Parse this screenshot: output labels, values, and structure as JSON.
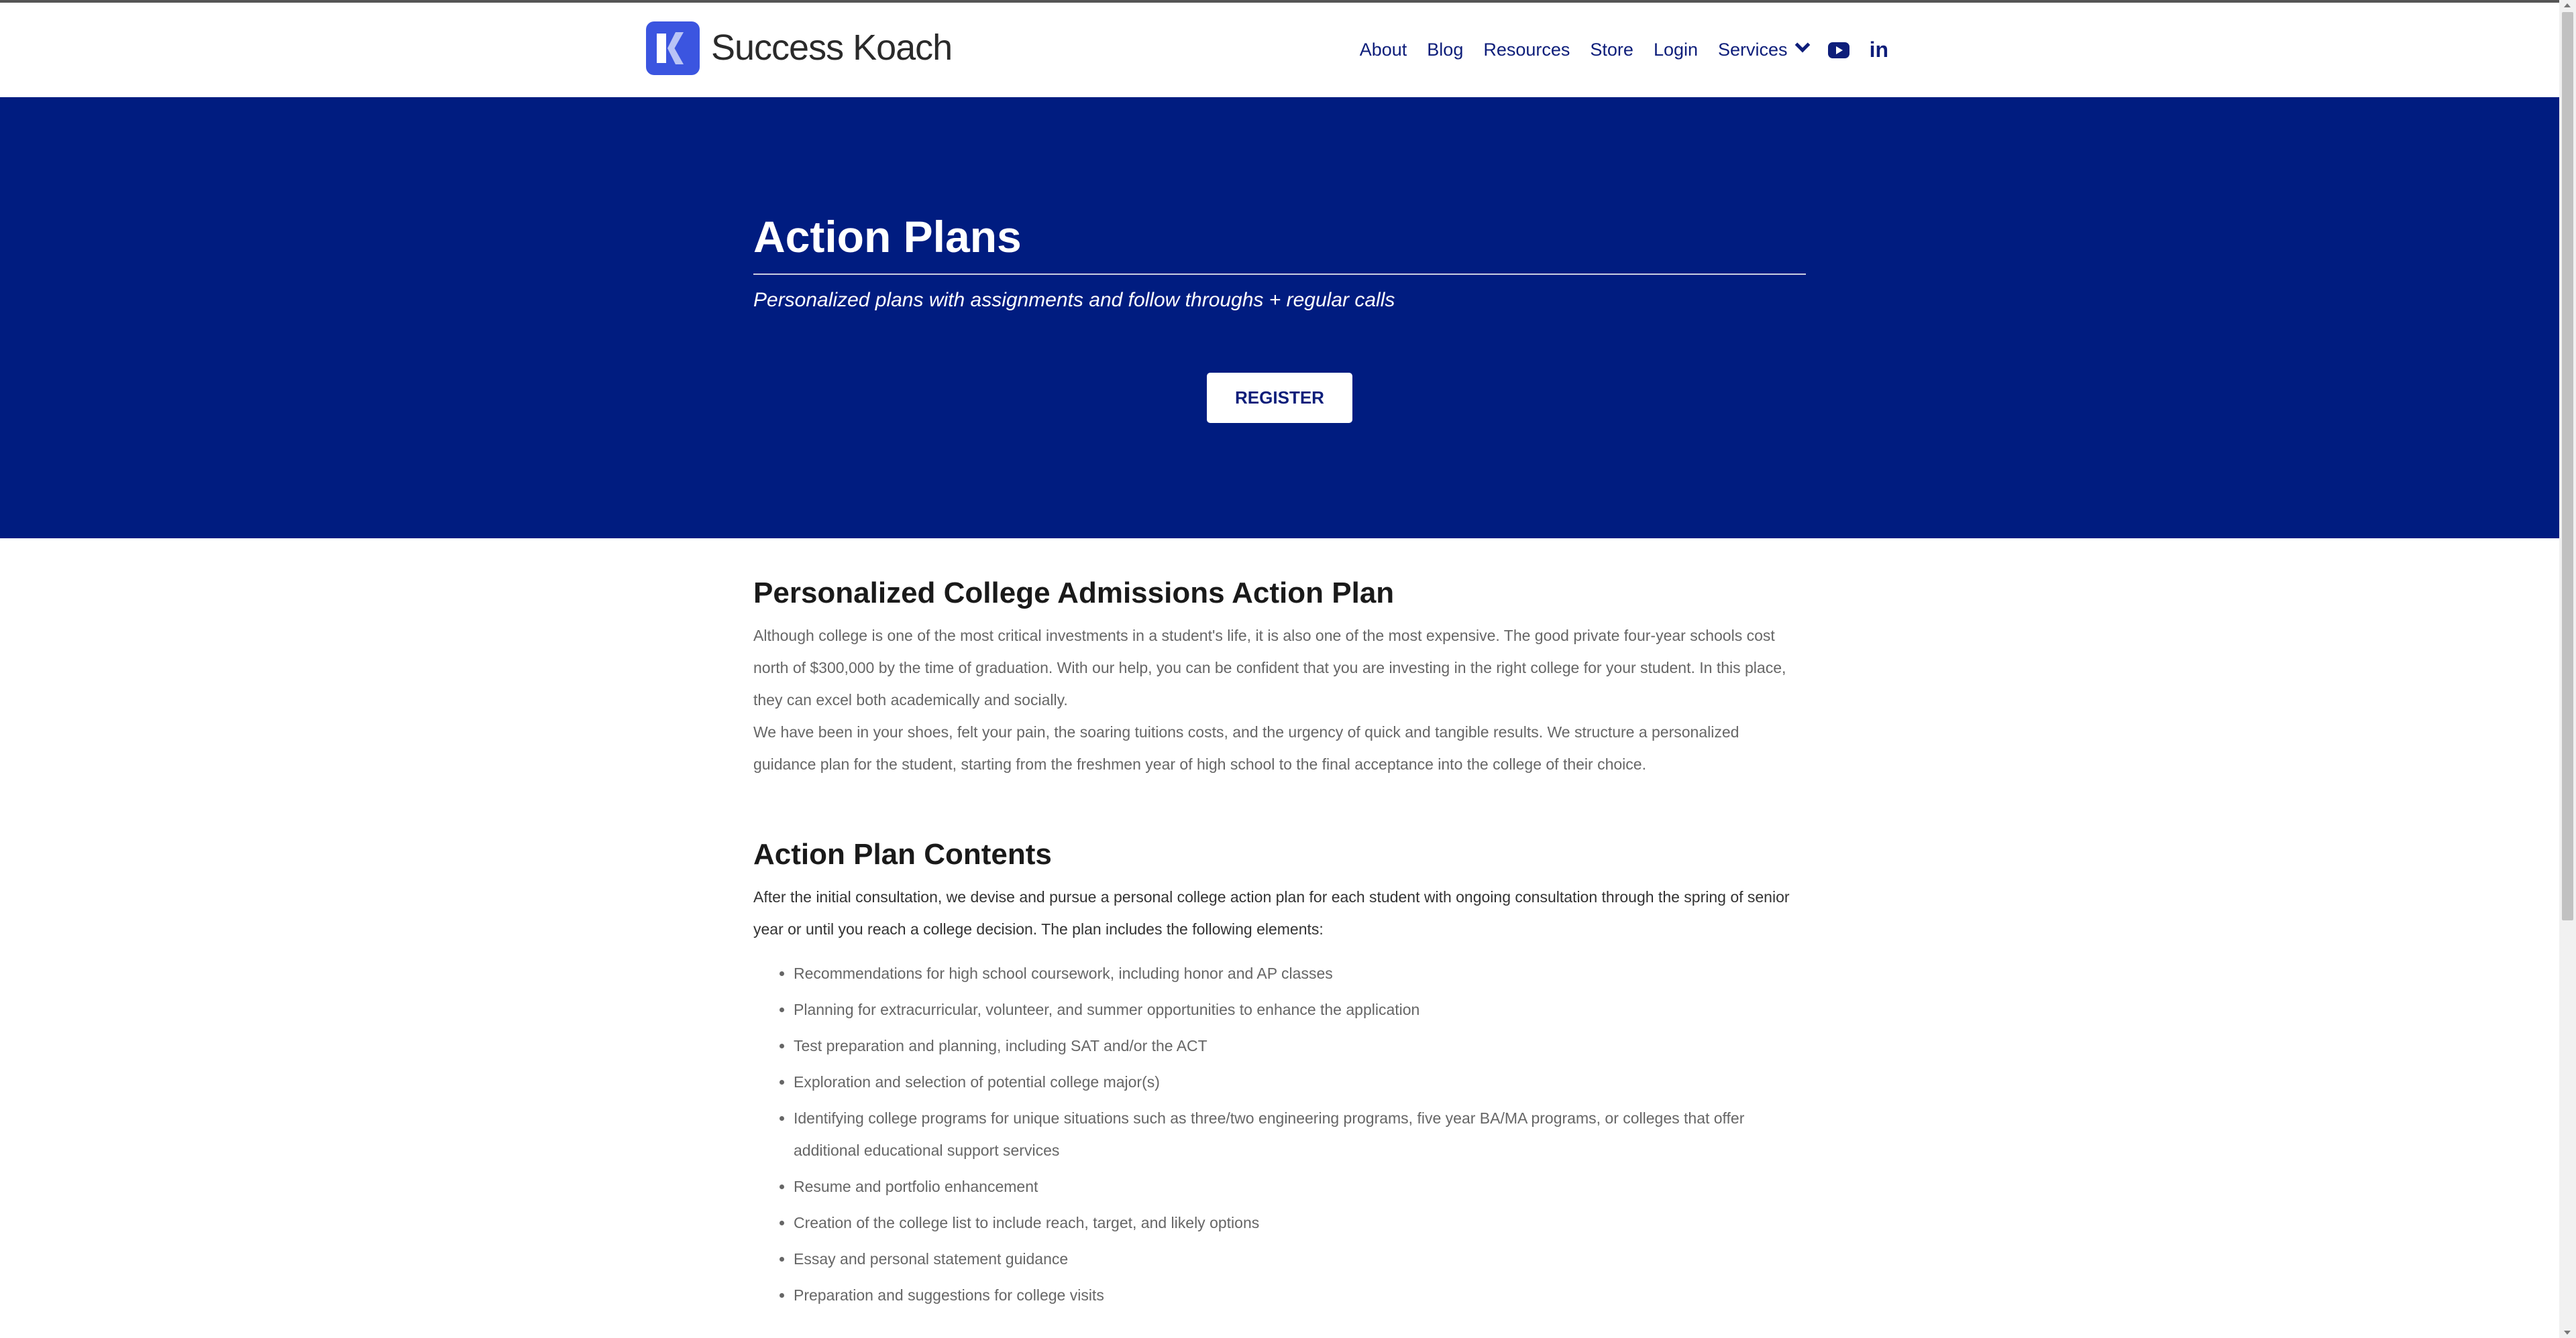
{
  "header": {
    "brand": "Success Koach",
    "nav": [
      "About",
      "Blog",
      "Resources",
      "Store",
      "Login",
      "Services"
    ],
    "icons": [
      "youtube-icon",
      "linkedin-icon"
    ],
    "linkedin_glyph": "in"
  },
  "hero": {
    "title": "Action Plans",
    "subtitle": "Personalized plans with assignments and follow throughs + regular calls",
    "button": "REGISTER",
    "bg_color": "#001c80"
  },
  "section1": {
    "title": "Personalized College Admissions Action Plan",
    "paragraphs": [
      "Although college is one of the most critical investments in a student's life, it is also one of the most expensive.  The good private four-year schools cost north of $300,000 by the time of graduation.  With our help, you can be confident that you are investing in the right college for your student. In this place, they can excel both academically and socially.",
      "We have been in your shoes, felt your pain, the soaring tuitions costs, and the urgency of quick and tangible results. We structure a personalized guidance plan for the student, starting from the freshmen year of high school to the final acceptance into the college of their choice."
    ]
  },
  "section2": {
    "title": "Action Plan Contents",
    "intro": "After the initial consultation, we devise and pursue a personal college action plan for each student with ongoing consultation through the spring of senior year or until you reach a college decision.  The plan includes the following elements:",
    "items": [
      "Recommendations for high school coursework, including honor and AP classes",
      "Planning for extracurricular, volunteer, and summer opportunities to enhance the application",
      "Test preparation and planning, including SAT and/or the ACT",
      "Exploration and selection of potential college major(s)",
      "Identifying college programs for unique situations such as three/two engineering programs, five year BA/MA programs, or colleges that offer additional educational support services",
      "Resume and portfolio enhancement",
      "Creation of the college list to include reach, target, and likely options",
      "Essay and personal statement guidance",
      "Preparation and suggestions for college visits"
    ]
  }
}
